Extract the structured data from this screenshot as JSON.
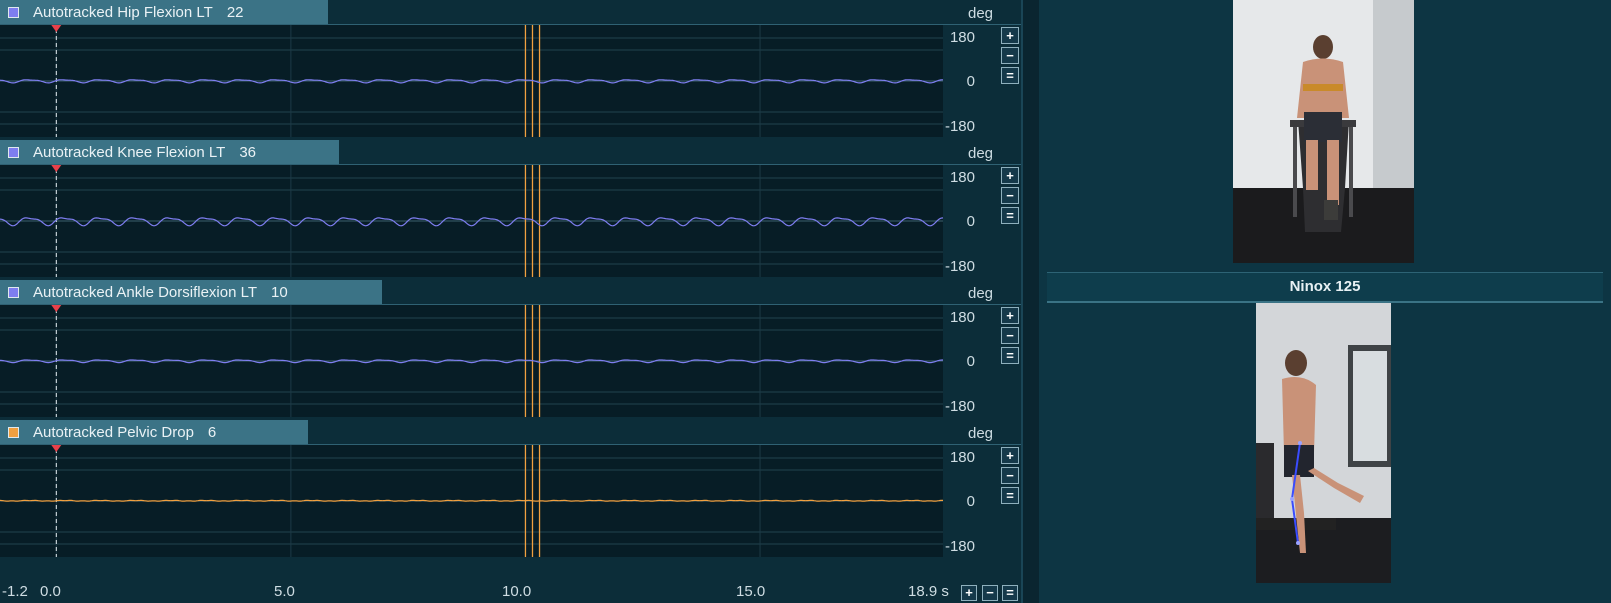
{
  "panels": [
    {
      "name": "Autotracked Hip Flexion LT",
      "value": "22",
      "unit": "deg",
      "color": "#7e7ef0",
      "ticks": [
        "180",
        "0",
        "-180"
      ],
      "amp": 6,
      "freq": 1.33
    },
    {
      "name": "Autotracked Knee Flexion LT",
      "value": "36",
      "unit": "deg",
      "color": "#7e7ef0",
      "ticks": [
        "180",
        "0",
        "-180"
      ],
      "amp": 15,
      "freq": 1.33
    },
    {
      "name": "Autotracked Ankle Dorsiflexion LT",
      "value": "10",
      "unit": "deg",
      "color": "#7e7ef0",
      "ticks": [
        "180",
        "0",
        "-180"
      ],
      "amp": 5,
      "freq": 1.33
    },
    {
      "name": "Autotracked Pelvic Drop",
      "value": "6",
      "unit": "deg",
      "color": "#f0a040",
      "ticks": [
        "180",
        "0",
        "-180"
      ],
      "amp": 2,
      "freq": 1.33
    }
  ],
  "time_axis": {
    "labels": [
      "-1.2",
      "0.0",
      "5.0",
      "10.0",
      "15.0",
      "18.9 s"
    ],
    "buttons": [
      "+",
      "−",
      "="
    ]
  },
  "panel_buttons": [
    "+",
    "−",
    "="
  ],
  "camera2_title": "Ninox 125",
  "accent_marker_color": "#e8404a",
  "cursor_color": "#f0a040"
}
